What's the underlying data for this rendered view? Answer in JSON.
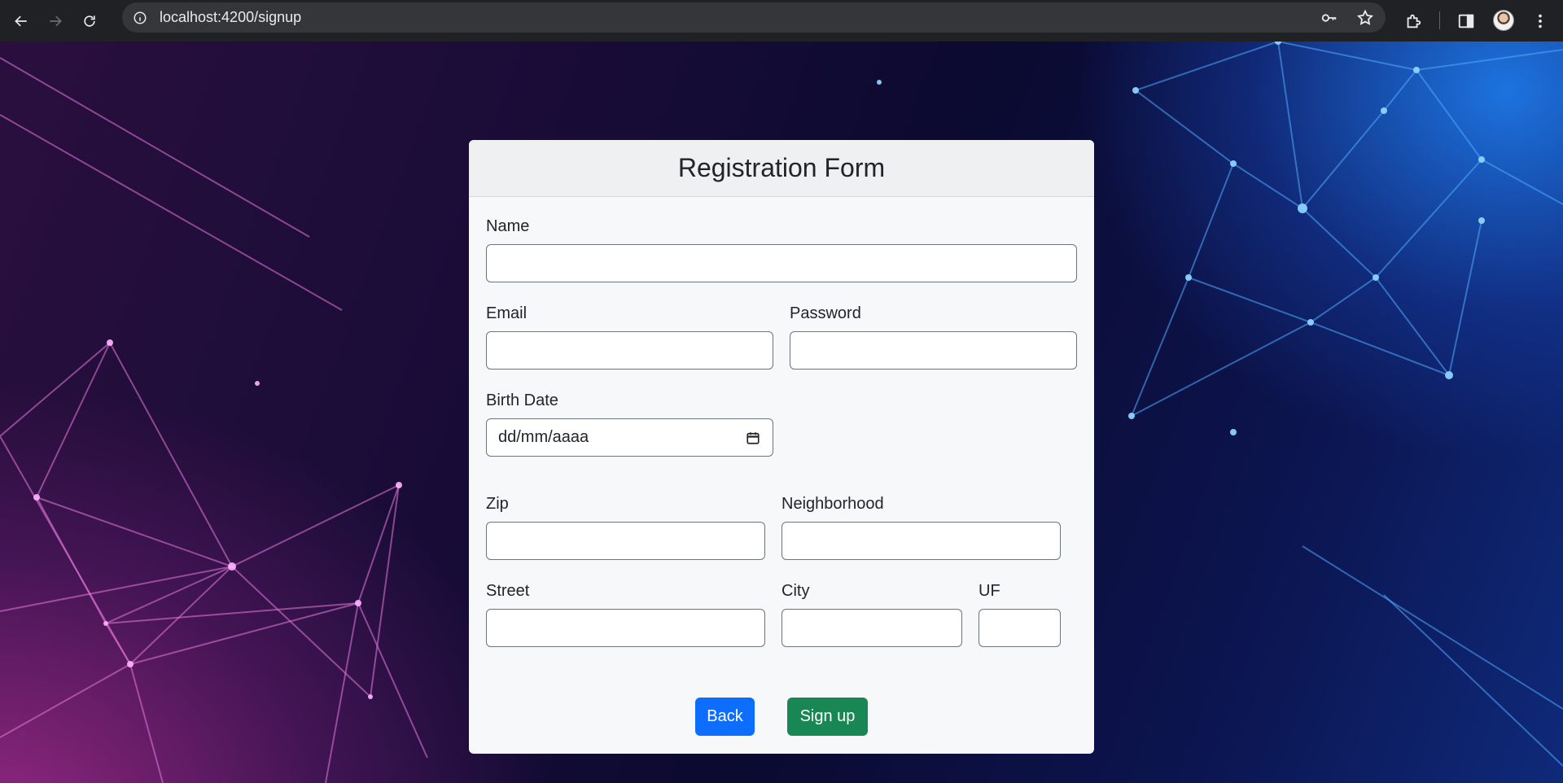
{
  "browser": {
    "url": "localhost:4200/signup"
  },
  "form": {
    "title": "Registration Form",
    "fields": {
      "name": {
        "label": "Name",
        "value": ""
      },
      "email": {
        "label": "Email",
        "value": ""
      },
      "password": {
        "label": "Password",
        "value": ""
      },
      "birth_date": {
        "label": "Birth Date",
        "placeholder": "dd/mm/aaaa"
      },
      "zip": {
        "label": "Zip",
        "value": ""
      },
      "neighborhood": {
        "label": "Neighborhood",
        "value": ""
      },
      "street": {
        "label": "Street",
        "value": ""
      },
      "city": {
        "label": "City",
        "value": ""
      },
      "uf": {
        "label": "UF",
        "value": ""
      }
    },
    "buttons": {
      "back": "Back",
      "signup": "Sign up"
    }
  },
  "colors": {
    "back_button": "#0d6efd",
    "signup_button": "#198754"
  }
}
